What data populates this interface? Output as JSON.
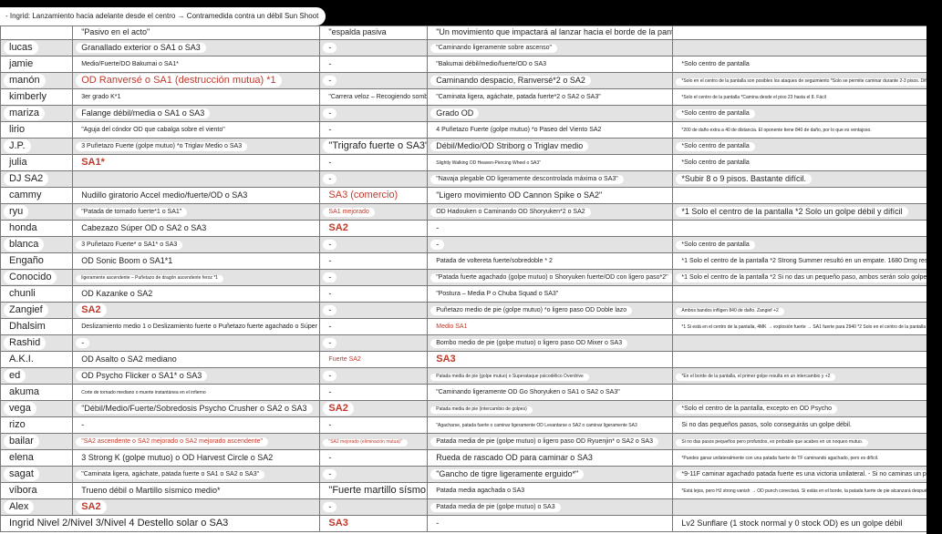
{
  "title": "- Ingrid: Lanzamiento hacia adelante desde el centro → Contramedida contra un débil Sun Shoot",
  "colors": {
    "accent_red": "#c0392b",
    "row_alt": "#e3e3e3",
    "border": "#777777"
  },
  "header_row": {
    "name": "",
    "col1": "\"Pasivo en el acto\"",
    "col2": "\"espalda pasiva",
    "col3": "\"Un movimiento que impactará al lanzar hacia el borde de la pantalla\"",
    "col4": ""
  },
  "rows": [
    {
      "name": "lucas",
      "c1": "Granallado exterior o SA1 o SA3",
      "c1s": "m",
      "c2": "-",
      "c3": "\"Caminando ligeramente sobre ascenso\"",
      "c3s": "s",
      "c4": ""
    },
    {
      "name": "jamie",
      "c1": "Medio/Fuerte/DO Bakumai o SA1*",
      "c1s": "s",
      "c2": "-",
      "c3": "\"Bakumai débil/medio/fuerte/OD o SA3",
      "c3s": "s",
      "c4": "*Solo centro de pantalla",
      "c4s": "s"
    },
    {
      "name": "manón",
      "c1": "OD Ranversé o SA1 (destrucción mutua) *1",
      "c1s": "l",
      "c1c": "red",
      "c2": "-",
      "c3": "Caminando despacio, Ranversé*2 o SA2",
      "c3s": "m",
      "c4": "*Solo en el centro de la pantalla son posibles los ataques de seguimiento *Solo se permite caminar durante 2-3 pisos. Dificultad alta.",
      "c4s": "xs"
    },
    {
      "name": "kimberly",
      "c1": "3er grado K*1",
      "c1s": "s",
      "c2": "\"Carrera veloz – Recogiendo sombras\"",
      "c2s": "s",
      "c3": "\"Caminata ligera, agáchate, patada fuerte*2 o SA2 o SA3\"",
      "c3s": "s",
      "c4": "*Solo el centro de la pantalla *Camina desde el piso 23 hasta el 8. Fácil",
      "c4s": "xs"
    },
    {
      "name": "mariza",
      "c1": "Falange débil/media o SA1 o SA3",
      "c1s": "m",
      "c2": "-",
      "c3": "Grado OD",
      "c3s": "m",
      "c4": "*Solo centro de pantalla",
      "c4s": "s"
    },
    {
      "name": "lirio",
      "c1": "\"Aguja del cóndor OD que cabalga sobre el viento\"",
      "c1s": "s",
      "c2": "-",
      "c3": "4 Puñetazo Fuerte (golpe mutuo) *o Paseo del Viento SA2",
      "c3s": "s",
      "c4": "*200 de daño extra a 40 de distancia. El oponente tiene 840 de daño, por lo que es ventajoso.",
      "c4s": "xs"
    },
    {
      "name": "J.P.",
      "c1": "3 Puñetazo Fuerte (golpe mutuo) *o Triglav Medio o SA3",
      "c1s": "s",
      "c2": "\"Trigrafo fuerte o SA3\"",
      "c2s": "l",
      "c3": "Débil/Medio/OD Striborg o Triglav medio",
      "c3s": "m",
      "c4": "*Solo centro de pantalla",
      "c4s": "s"
    },
    {
      "name": "julia",
      "c1": "SA1*",
      "c1s": "l",
      "c1c": "redb",
      "c2": "-",
      "c3": "Slightly Walking OD Heaven-Piercing Wheel o SA3\"",
      "c3s": "xs",
      "c4": "*Solo centro de pantalla",
      "c4s": "s"
    },
    {
      "name": "DJ SA2",
      "c1": "",
      "c2": "-",
      "c3": "\"Navaja plegable OD ligeramente descontrolada máxima o SA3\"",
      "c3s": "s",
      "c4": "*Subir 8 o 9 pisos. Bastante difícil.",
      "c4s": "m"
    },
    {
      "name": "cammy",
      "c1": "Nudillo giratorio Accel medio/fuerte/OD o SA3",
      "c1s": "m",
      "c2": "SA3 (comercio)",
      "c2s": "l",
      "c2c": "red",
      "c3": "\"Ligero movimiento OD Cannon Spike o SA2\"",
      "c3s": "m",
      "c4": ""
    },
    {
      "name": "ryu",
      "c1": "\"Patada de tornado fuerte*1 o SA1\"",
      "c1s": "s",
      "c2": "SA1 mejorado",
      "c2s": "s",
      "c2c": "red",
      "c3": "OD Hadouken o Caminando OD Shoryuken*2 o SA2",
      "c3s": "s",
      "c4": "*1 Solo el centro de la pantalla *2 Solo un golpe débil y difícil",
      "c4s": "m"
    },
    {
      "name": "honda",
      "c1": "Cabezazo Súper OD o SA2 o SA3",
      "c1s": "m",
      "c2": "SA2",
      "c2s": "l",
      "c2c": "redb",
      "c3": "-",
      "c3s": "m",
      "c4": ""
    },
    {
      "name": "blanca",
      "c1": "3 Puñetazo Fuerte* o SA1* o SA3",
      "c1s": "s",
      "c2": "-",
      "c3": "-",
      "c3s": "m",
      "c4": "*Solo centro de pantalla",
      "c4s": "s"
    },
    {
      "name": "Engaño",
      "c1": "OD Sonic Boom o SA1*1",
      "c1s": "m",
      "c2": "-",
      "c3": "Patada de voltereta fuerte/sobredoble * 2",
      "c3s": "s",
      "c4": "*1 Solo el centro de la pantalla *2 Strong Summer resultó en un empate. 1680 Dmg reset",
      "c4s": "s"
    },
    {
      "name": "Conocido",
      "c1": "ligeramente ascendente – Puñetazo de dragón ascendente feroz *1",
      "c1s": "xs",
      "c2": "-",
      "c3": "\"Patada fuerte agachado (golpe mutuo) o Shoryuken fuerte/OD con ligero paso*2\"",
      "c3s": "s",
      "c4": "*1 Solo el centro de la pantalla *2 Si no das un pequeño paso, ambos serán solo golpes débiles.",
      "c4s": "s"
    },
    {
      "name": "chunli",
      "c1": "OD Kazanke o SA2",
      "c1s": "m",
      "c2": "-",
      "c3": "\"Postura – Media P o Chuba Squad o SA3\"",
      "c3s": "s",
      "c4": ""
    },
    {
      "name": "Zangief",
      "c1": "SA2",
      "c1s": "l",
      "c1c": "redb",
      "c2": "-",
      "c3": "Puñetazo medio de pie (golpe mutuo) *o ligero paso OD Doble lazo",
      "c3s": "s",
      "c4": "Ambos bandos infligen 840 de daño. Zangief +2",
      "c4s": "xs"
    },
    {
      "name": "Dhalsim",
      "c1": "Deslizamiento medio 1 o Deslizamiento fuerte o Puñetazo fuerte agachado o Súper arte débil 1*2",
      "c1s": "s",
      "c2": "-",
      "c3": "Medio SA1",
      "c3s": "s",
      "c3c": "red",
      "c4": "*1 Si está en el centro de la pantalla, 4MK → explosión fuerte → SA1 fuerte para 2940 *2 Solo en el centro de la pantalla",
      "c4s": "xs"
    },
    {
      "name": "Rashid",
      "c1": "-",
      "c2": "-",
      "c3": "Bombo medio de pie (golpe mutuo) o ligero paso OD Mixer o SA3",
      "c3s": "s",
      "c4": ""
    },
    {
      "name": "A.K.I.",
      "c1": "OD Asalto o SA2 mediano",
      "c1s": "m",
      "c2": "Fuerte SA2",
      "c2s": "s",
      "c2c": "red",
      "c3": "SA3",
      "c3s": "l",
      "c3c": "redb",
      "c4": ""
    },
    {
      "name": "ed",
      "c1": "OD Psycho Flicker o SA1* o SA3",
      "c1s": "m",
      "c2": "-",
      "c3": "Patada media de pie (golpe mutuo) o Superataque psicodélico Overdrive",
      "c3s": "xs",
      "c4": "*En el borde de la pantalla, el primer golpe resulta en un intercambio y +2",
      "c4s": "xs"
    },
    {
      "name": "akuma",
      "c1": "Corte de tornado mediano o muerte instantánea en el infierno",
      "c1s": "xs",
      "c2": "-",
      "c3": "\"Caminando ligeramente OD Go Shoryuken o SA1 o SA2 o SA3\"",
      "c3s": "s",
      "c4": ""
    },
    {
      "name": "vega",
      "c1": "\"Débil/Medio/Fuerte/Sobredosis Psycho Crusher o SA2 o SA3",
      "c1s": "m",
      "c2": "SA2",
      "c2s": "l",
      "c2c": "redb",
      "c3": "Patada media de pie (intercambio de golpes)",
      "c3s": "xs",
      "c4": "*Solo el centro de la pantalla, excepto en OD Psycho",
      "c4s": "s"
    },
    {
      "name": "rizo",
      "c1": "-",
      "c2": "-",
      "c3": "\"Agacharse, patada fuerte o caminar ligeramente OD Levantarse o SA2 o caminar ligeramente SA3",
      "c3s": "xs",
      "c4": "Si no das pequeños pasos, solo conseguirás un golpe débil.",
      "c4s": "s"
    },
    {
      "name": "bailar",
      "c1": "\"SA2 ascendente o SA2 mejorado o SA2 mejorado ascendente\"",
      "c1s": "s",
      "c1c": "red",
      "c2": "\"SA2 mejorado (eliminación mutua)\"",
      "c2s": "xs",
      "c2c": "red",
      "c3": "Patada media de pie (golpe mutuo) o ligero paso OD Ryuenjin* o SA2 o SA3",
      "c3s": "s",
      "c4": "Si no das pasos pequeños pero profundos, es probable que acabes en un noqueo mutuo.",
      "c4s": "xs"
    },
    {
      "name": "elena",
      "c1": "3 Strong K (golpe mutuo) o OD Harvest Circle o SA2",
      "c1s": "m",
      "c2": "-",
      "c3": "Rueda de rascado OD para caminar o SA3",
      "c3s": "m",
      "c4": "*Puedes ganar unilateralmente con una patada fuerte de TF caminando agachado, pero es difícil.",
      "c4s": "xs"
    },
    {
      "name": "sagat",
      "c1": "\"Caminata ligera, agáchate, patada fuerte o SA1 o SA2 o SA3\"",
      "c1s": "s",
      "c2": "-",
      "c3": "\"Gancho de tigre ligeramente erguido*\"",
      "c3s": "m",
      "c4": "*9-11F caminar agachado patada fuerte es una victoria unilateral. - Si no caminas un poco, solo será un golpe débil.",
      "c4s": "s"
    },
    {
      "name": "víbora",
      "c1": "Trueno débil o Martillo sísmico medio*",
      "c1s": "m",
      "c2": "\"Fuerte martillo sísmo",
      "c2s": "l",
      "c3": "Patada media agachada o SA3",
      "c3s": "s",
      "c4": "*Está lejos, pero HJ strong vanish → OD punch conectará. Si estás en el borde, la patada fuerte de pie alcanzará después de vanish.",
      "c4s": "xs"
    },
    {
      "name": "Alex",
      "c1": "SA2",
      "c1s": "l",
      "c1c": "redb",
      "c2": "-",
      "c3": "Patada media de pie (golpe mutuo) o SA3",
      "c3s": "s",
      "c4": ""
    }
  ],
  "footer_row": {
    "name": "Ingrid Nivel 2/Nivel 3/Nivel 4 Destello solar o SA3",
    "c2": "SA3",
    "c3": "-",
    "c4": "Lv2 Sunflare (1 stock normal y 0 stock OD) es un golpe débil"
  }
}
